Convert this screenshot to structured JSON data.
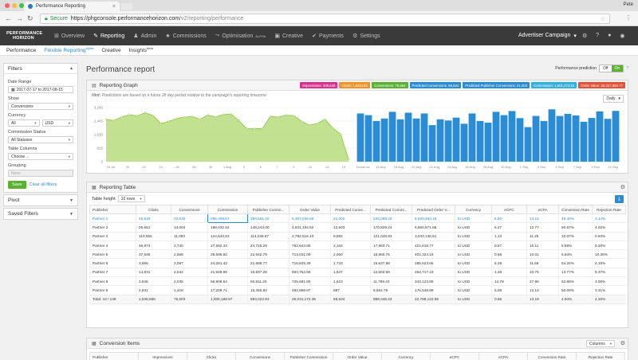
{
  "browser": {
    "tab_title": "Performance Reporting",
    "profile": "Pete",
    "secure_label": "Secure",
    "url_domain": "https://phgconsole.performancehorizon.com",
    "url_path": "/v2/reporting/performance"
  },
  "app": {
    "logo_line1": "PERFORMANCE",
    "logo_line2": "HORIZON",
    "nav": [
      {
        "label": "Overview",
        "icon": "dashboard-icon"
      },
      {
        "label": "Reporting",
        "icon": "reporting-icon"
      },
      {
        "label": "Admin",
        "icon": "admin-icon"
      },
      {
        "label": "Commissions",
        "icon": "star-icon"
      },
      {
        "label": "Optimisation",
        "sup": "ALPHA",
        "icon": "optimisation-icon"
      },
      {
        "label": "Creative",
        "icon": "image-icon"
      },
      {
        "label": "Payments",
        "icon": "payments-icon"
      },
      {
        "label": "Settings",
        "icon": "settings-icon"
      }
    ],
    "campaign_label": "Advertiser Campaign"
  },
  "subnav": {
    "performance": "Performance",
    "flexible": "Flexible Reporting",
    "flexible_sup": "alpha",
    "creative": "Creative",
    "insights": "Insights",
    "insights_sup": "beta"
  },
  "filters": {
    "title": "Filters",
    "date_range_label": "Date Range",
    "date_range_value": "2017-07-17 to 2017-08-15",
    "show_label": "Show",
    "show_value": "Conversions",
    "currency_label": "Currency",
    "currency_all": "All",
    "currency_value": "USD",
    "commission_status_label": "Commission Status",
    "commission_status_value": "All Statuses",
    "table_columns_label": "Table Columns",
    "table_columns_value": "Choose ...",
    "grouping_label": "Grouping",
    "grouping_value": "None",
    "save_label": "Save",
    "clear_label": "Clear all filters",
    "pivot_label": "Pivot",
    "saved_filters_label": "Saved Filters"
  },
  "report": {
    "title": "Performance report",
    "prediction_label": "Performance prediction",
    "toggle_off": "Off",
    "toggle_on": "On",
    "help": "?"
  },
  "graph": {
    "title": "Reporting Graph",
    "hint_bold": "Hint:",
    "hint_text": "Predictions are based on a future 28 day period relative to the campaign's reporting timezone",
    "period": "Daily",
    "badges": [
      {
        "label": "Impressions: 308,649",
        "color": "#d6338f"
      },
      {
        "label": "Clicks: 1,536,011",
        "color": "#f0932b"
      },
      {
        "label": "Conversions: 75,664",
        "color": "#5cb033"
      },
      {
        "label": "Predicted Conversions: 68,534",
        "color": "#2a8dd4"
      },
      {
        "label": "Predicted Publisher Conversions: 21,003",
        "color": "#2a8dd4"
      },
      {
        "label": "Commission: 1,601,273.64",
        "color": "#34b0e0"
      },
      {
        "label": "Order Value: 25,037,894.77",
        "color": "#e55039"
      }
    ]
  },
  "chart_data": [
    {
      "type": "area",
      "series": [
        {
          "name": "Conversions",
          "color": "#8cc63f"
        }
      ],
      "x_ticks": [
        "16 Jul",
        "20",
        "22",
        "24",
        "26",
        "28",
        "30",
        "1 Aug",
        "3",
        "5",
        "7",
        "9",
        "11",
        "13",
        "15"
      ],
      "y_ticks": [
        "0",
        "815",
        "1,630",
        "2,445",
        "3,260"
      ],
      "ylim": [
        0,
        3260
      ],
      "values": [
        2550,
        2480,
        2700,
        2820,
        2760,
        2950,
        2780,
        2300,
        2420,
        2600,
        2680,
        2720,
        2560,
        2800,
        2700,
        2840,
        2860,
        2470,
        1980,
        1980,
        2000,
        2720,
        2690,
        2800,
        2770,
        2430,
        2200,
        2300,
        2550,
        2020,
        1650,
        150
      ]
    },
    {
      "type": "bar",
      "series": [
        {
          "name": "Predicted Conversions",
          "color": "#2a8dd4"
        }
      ],
      "x_ticks": [
        "Tomorrow",
        "16 Aug",
        "18 Aug",
        "20 Aug",
        "22 Aug",
        "24 Aug",
        "26 Aug",
        "28 Aug",
        "30 Aug",
        "1 Sep",
        "3 Sep",
        "5 Sep",
        "7 Sep",
        "9 Sep",
        "11 Sep"
      ],
      "ylim": [
        0,
        3260
      ],
      "values": [
        2900,
        2800,
        2450,
        2600,
        3000,
        2550,
        2950,
        2600,
        2900,
        2200,
        2550,
        2480,
        2650,
        2280,
        2900,
        2450,
        2350,
        3000,
        2800,
        3050,
        2620,
        2080,
        2750,
        2450,
        3150,
        2750,
        2880,
        2780,
        2400,
        2630,
        3030,
        2580,
        3060
      ]
    }
  ],
  "table": {
    "title": "Reporting Table",
    "height_label": "Table height",
    "height_value": "10 rows",
    "columns": [
      "Publisher",
      "Clicks",
      "Conversions",
      "Commission",
      "Publisher Commi...",
      "Order Value",
      "Predicted Conve...",
      "Predicted Commi...",
      "Predicted Order V...",
      "Currency",
      "eCPC",
      "eCPA",
      "Conversion Rate",
      "Rejection Rate"
    ],
    "rows": [
      [
        "Partner 1",
        "45,619",
        "22,535",
        "296,308.67",
        "284,561.32",
        "6,367,036.69",
        "21,002",
        "245,068.29",
        "5,820,460.18",
        "to USD",
        "6.50",
        "13.15",
        "49.40%",
        "3.14%"
      ],
      [
        "Partner 2",
        "25,651",
        "13,003",
        "188,032.16",
        "148,243.00",
        "4,831,154.52",
        "12,603",
        "170,829.24",
        "5,860,871.86",
        "to USD",
        "6.47",
        "12.77",
        "50.67%",
        "4.02%"
      ],
      [
        "Partner 3",
        "110,055",
        "11,083",
        "124,643.53",
        "114,238.87",
        "2,792,516.10",
        "9,892",
        "121,048.93",
        "3,033,136.61",
        "to USD",
        "1.13",
        "11.25",
        "10.07%",
        "0.93%"
      ],
      [
        "Partner 4",
        "48,973",
        "2,740",
        "27,692.33",
        "24,725.29",
        "752,643.80",
        "2,164",
        "17,983.71",
        "421,618.77",
        "to USD",
        "0.57",
        "10.11",
        "5.59%",
        "9.20%"
      ],
      [
        "Partner 5",
        "37,548",
        "2,568",
        "25,695.92",
        "22,942.79",
        "713,031.09",
        "2,060",
        "18,860.76",
        "402,324.16",
        "to USD",
        "0.68",
        "10.01",
        "6.84%",
        "10.36%"
      ],
      [
        "Partner 6",
        "3,865",
        "2,097",
        "24,281.42",
        "21,688.77",
        "716,845.39",
        "1,743",
        "15,637.98",
        "285,523.65",
        "to USD",
        "6.28",
        "11.58",
        "54.26%",
        "4.15%"
      ],
      [
        "Partner 7",
        "14,831",
        "2,042",
        "21,948.99",
        "19,597.28",
        "593,752.66",
        "1,847",
        "12,602.59",
        "264,717.43",
        "to USD",
        "1.48",
        "10.75",
        "13.77%",
        "8.37%"
      ],
      [
        "Partner 8",
        "3,846",
        "2,035",
        "56,908.54",
        "50,811.20",
        "725,681.80",
        "1,623",
        "11,789.43",
        "243,123.89",
        "to USD",
        "14.79",
        "27.96",
        "52.88%",
        "3.00%"
      ],
      [
        "Partner 9",
        "2,831",
        "1,418",
        "17,209.71",
        "15,365.82",
        "482,998.97",
        "987",
        "8,554.76",
        "176,548.89",
        "to USD",
        "6.08",
        "12.14",
        "50.09%",
        "3.31%"
      ]
    ],
    "total": [
      "Total: 10 / 139",
      "1,536,966",
      "75,603",
      "1,000,189.97",
      "893,022.93",
      "25,031,172.35",
      "69,534",
      "988,348.43",
      "22,788,122.55",
      "to USD",
      "0.65",
      "13.18",
      "4.94%",
      "4.26%"
    ]
  },
  "conversion_items": {
    "title": "Conversion Items",
    "columns_button": "Columns",
    "columns": [
      "Publisher",
      "Impressions",
      "Clicks",
      "Conversions",
      "Publisher Commission",
      "Order Value",
      "Currency",
      "eCPC",
      "eCPA",
      "Conversion Rate",
      "Rejection Rate"
    ]
  }
}
